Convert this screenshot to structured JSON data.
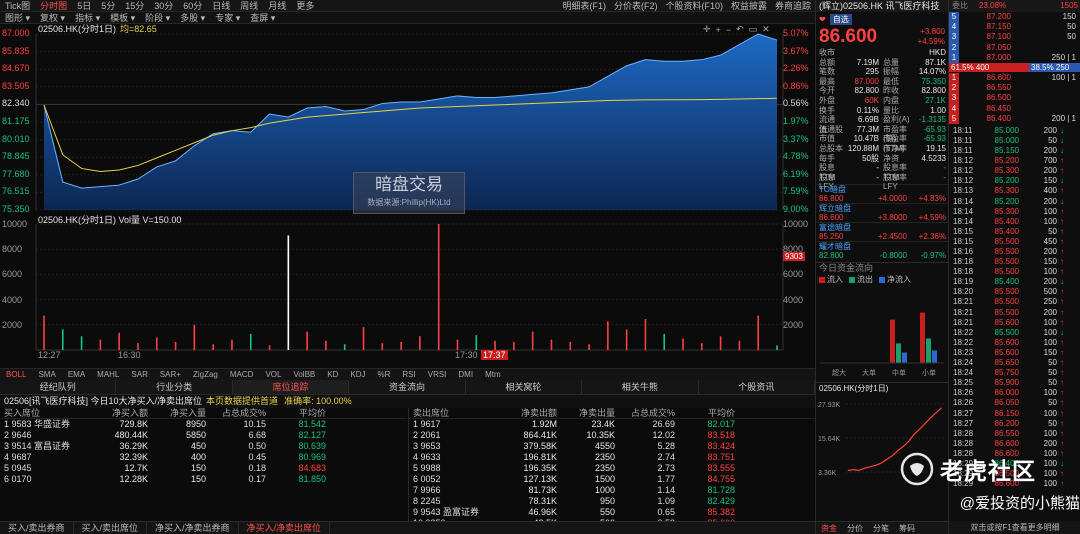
{
  "toolbar1": {
    "items": [
      "Tick图",
      "分时图",
      "5日",
      "5分",
      "15分",
      "30分",
      "60分",
      "日线",
      "周线",
      "月线",
      "更多"
    ],
    "active": 1,
    "right": [
      "明细表(F1)",
      "分价表(F2)",
      "个股资料(F10)",
      "权益披露",
      "券商追踪"
    ]
  },
  "toolbar2": {
    "items": [
      "图形",
      "复权",
      "指标",
      "模板",
      "阶段",
      "多股",
      "专家",
      "查屏"
    ]
  },
  "price_chart": {
    "label": "02506.HK(分时1日)",
    "avg_label": "均=82.65",
    "left_axis": [
      "87.000",
      "85.835",
      "84.670",
      "83.505",
      "82.340",
      "81.175",
      "80.010",
      "78.845",
      "77.680",
      "76.515",
      "75.350"
    ],
    "right_axis": [
      "5.07%",
      "3.67%",
      "2.26%",
      "0.86%",
      "0.56%",
      "1.97%",
      "3.37%",
      "4.78%",
      "6.19%",
      "7.59%",
      "9.00%"
    ],
    "watermark_title": "暗盘交易",
    "watermark_sub": "数据来源:Phillip(HK)Ltd"
  },
  "chart_data": {
    "type": "area",
    "title": "02506.HK(分时1日)",
    "ylim": [
      75.35,
      87.0
    ],
    "price": [
      82.3,
      77.2,
      76.8,
      76.9,
      77.0,
      77.4,
      78.2,
      78.6,
      79.6,
      80.4,
      80.6,
      80.5,
      81.7,
      81.5,
      82.1,
      82.2,
      81.9,
      82.0,
      82.4,
      82.5,
      82.5,
      82.7,
      82.9,
      82.8,
      82.8,
      82.9,
      83.0,
      83.1,
      83.3,
      83.5,
      84.2,
      84.9,
      85.3,
      85.2,
      85.2,
      85.3,
      85.6,
      86.3,
      87.0,
      86.6
    ],
    "avg": [
      82.3,
      79.0,
      78.1,
      77.9,
      78.0,
      78.3,
      78.8,
      79.3,
      79.8,
      80.3,
      80.6,
      80.8,
      81.1,
      81.3,
      81.5,
      81.6,
      81.7,
      81.8,
      81.9,
      82.0,
      82.1,
      82.15,
      82.2,
      82.25,
      82.3,
      82.35,
      82.4,
      82.45,
      82.5,
      82.55,
      82.6,
      82.62,
      82.64,
      82.65,
      82.65,
      82.66,
      82.67,
      82.7,
      82.72,
      82.75
    ],
    "volume": [
      3000,
      1800,
      1200,
      900,
      1500,
      600,
      1100,
      700,
      2200,
      500,
      900,
      1400,
      400,
      10000,
      1600,
      800,
      500,
      2000,
      600,
      700,
      1200,
      11000,
      900,
      1300,
      800,
      700,
      1600,
      900,
      700,
      500,
      2500,
      1800,
      2700,
      1400,
      1000,
      600,
      1200,
      800,
      3000,
      400
    ],
    "vol_label": "02506.HK(分时1日) Vol量 V=150.00",
    "vol_axis": [
      "10000",
      "8000",
      "6000",
      "4000",
      "2000"
    ],
    "vol_marker": "9303",
    "time_labels": [
      "12:27",
      "16:30",
      "17:30",
      "17:37"
    ]
  },
  "indicators": [
    "BOLL",
    "SMA",
    "EMA",
    "MAHL",
    "SAR",
    "SAR+",
    "ZigZag",
    "MACD",
    "VOL",
    "VolBB",
    "KD",
    "KDJ",
    "%R",
    "RSI",
    "VRSI",
    "DMI",
    "Mtm"
  ],
  "tabs2": [
    "经纪队列",
    "行业分类",
    "席位追踪",
    "资金流向",
    "相关窝轮",
    "相关牛熊",
    "个股资讯"
  ],
  "tabs2_active": 2,
  "broker_header": {
    "left": "02506[讯飞医疗科技]  今日10大净买入/净卖出席位",
    "warn": "本页数据提供首道",
    "rate": "准确率: 100.00%"
  },
  "buy_table": {
    "headers": [
      "买入席位",
      "净买入额",
      "净买入量",
      "占总成交%",
      "平均价"
    ],
    "rows": [
      [
        "1  9583  华盛证券",
        "729.8K",
        "8950",
        "10.15",
        "81.542"
      ],
      [
        "2  9646",
        "480.44K",
        "5850",
        "6.68",
        "82.127"
      ],
      [
        "3  9514  富昌证券",
        "36.29K",
        "450",
        "0.50",
        "80.639"
      ],
      [
        "4  9687",
        "32.39K",
        "400",
        "0.45",
        "80.969"
      ],
      [
        "5  0945",
        "12.7K",
        "150",
        "0.18",
        "84.683"
      ],
      [
        "6  0170",
        "12.28K",
        "150",
        "0.17",
        "81.850"
      ]
    ]
  },
  "sell_table": {
    "headers": [
      "卖出席位",
      "净卖出额",
      "净卖出量",
      "占总成交%",
      "平均价"
    ],
    "rows": [
      [
        "1  9617",
        "1.92M",
        "23.4K",
        "26.69",
        "82.017"
      ],
      [
        "2  2061",
        "864.41K",
        "10.35K",
        "12.02",
        "83.518"
      ],
      [
        "3  9653",
        "379.58K",
        "4550",
        "5.28",
        "83.424"
      ],
      [
        "4  9633",
        "196.81K",
        "2350",
        "2.74",
        "83.751"
      ],
      [
        "5  9988",
        "196.35K",
        "2350",
        "2.73",
        "83.555"
      ],
      [
        "6  0052",
        "127.13K",
        "1500",
        "1.77",
        "84.755"
      ],
      [
        "7  9966",
        "81.73K",
        "1000",
        "1.14",
        "81.728"
      ],
      [
        "8  2245",
        "78.31K",
        "950",
        "1.09",
        "82.429"
      ],
      [
        "9  9543  盈富证券",
        "46.96K",
        "550",
        "0.65",
        "85.382"
      ],
      [
        "10  0350",
        "42.5K",
        "500",
        "0.59",
        "85.000"
      ]
    ]
  },
  "bottom_tabs": [
    "买入/卖出券商",
    "买入/卖出席位",
    "净买入/净卖出券商",
    "净买入/净卖出席位"
  ],
  "bottom_active": 3,
  "quote": {
    "title": "(辉立)02506.HK  讯飞医疗科技",
    "badge": "自选",
    "price": "86.600",
    "change": "+3.800",
    "pct": "+4.59%",
    "currency_label": "收市",
    "currency": "HKD",
    "stats": [
      [
        "总额",
        "7.19M",
        "总量",
        "87.1K"
      ],
      [
        "笔数",
        "295",
        "振幅",
        "14.07%"
      ],
      [
        "最高",
        "87.000",
        "最低",
        "75.350"
      ],
      [
        "今开",
        "82.800",
        "昨收",
        "82.800"
      ],
      [
        "外盘",
        "60K",
        "内盘",
        "27.1K"
      ],
      [
        "换手",
        "0.11%",
        "量比",
        "1.00"
      ],
      [
        "流通值",
        "6.69B",
        "盈利(A)",
        "-1.3135"
      ],
      [
        "流通股",
        "77.3M",
        "市盈率(静)",
        "-65.93"
      ],
      [
        "市值",
        "10.47B",
        "市盈率(TTM)",
        "-65.93"
      ],
      [
        "总股本",
        "120.88M",
        "市净率",
        "19.15"
      ],
      [
        "每手",
        "50股",
        "净资",
        "4.5233"
      ],
      [
        "股息TTM",
        "-",
        "股息率TTM",
        "-"
      ],
      [
        "股息LFY",
        "-",
        "股息率LFY",
        "-"
      ]
    ],
    "markets": [
      {
        "name": "TO暗盘",
        "price": "86.800",
        "chg": "+4.0000",
        "pct": "+4.83%"
      },
      {
        "name": "辉立暗盘",
        "price": "86.600",
        "chg": "+3.8000",
        "pct": "+4.59%"
      },
      {
        "name": "富途暗盘",
        "price": "85.250",
        "chg": "+2.4500",
        "pct": "+2.36%"
      },
      {
        "name": "耀才暗盘",
        "price": "82.800",
        "chg": "-0.8000",
        "pct": "-0.97%"
      }
    ],
    "flow_title": "今日资金流向",
    "flow_legend": [
      "流入",
      "流出",
      "净流入"
    ],
    "flow_cats": [
      "超大",
      "大单",
      "中单",
      "小单"
    ],
    "mini_label": "02506.HK(分时1日)",
    "mini_axis": [
      "27.93K",
      "15.64K",
      "3.36K"
    ],
    "bottom_tabs": [
      "资金",
      "分价",
      "分笔",
      "筹码"
    ]
  },
  "book": {
    "header": [
      "委比",
      "23.08%",
      "1505"
    ],
    "asks": [
      [
        "87.200",
        "150"
      ],
      [
        "87.150",
        "50"
      ],
      [
        "87.100",
        "50"
      ],
      [
        "87.050",
        ""
      ],
      [
        "87.000",
        "250 | 1"
      ]
    ],
    "ratio_left": "61.5% 400",
    "ratio_right": "38.5% 250",
    "bids": [
      [
        "86.600",
        "100 | 1"
      ],
      [
        "86.550",
        ""
      ],
      [
        "86.500",
        ""
      ],
      [
        "86.450",
        ""
      ],
      [
        "86.400",
        "200 | 1"
      ]
    ],
    "ticks": [
      [
        "18:11",
        "85.000",
        "200",
        "down"
      ],
      [
        "18:11",
        "85.000",
        "50",
        "down"
      ],
      [
        "18:11",
        "85.150",
        "200",
        "down"
      ],
      [
        "18:12",
        "85.200",
        "700",
        "up"
      ],
      [
        "18:12",
        "85.300",
        "200",
        "up"
      ],
      [
        "18:12",
        "85.200",
        "150",
        "down"
      ],
      [
        "18:13",
        "85.300",
        "400",
        "up"
      ],
      [
        "18:14",
        "85.200",
        "200",
        "down"
      ],
      [
        "18:14",
        "85.300",
        "100",
        "up"
      ],
      [
        "18:14",
        "85.400",
        "100",
        "up"
      ],
      [
        "18:15",
        "85.400",
        "50",
        "up"
      ],
      [
        "18:15",
        "85.500",
        "450",
        "up"
      ],
      [
        "18:16",
        "85.500",
        "200",
        "up"
      ],
      [
        "18:18",
        "85.500",
        "150",
        "up"
      ],
      [
        "18:18",
        "85.500",
        "100",
        "up"
      ],
      [
        "18:19",
        "85.400",
        "200",
        "down"
      ],
      [
        "18:20",
        "85.500",
        "500",
        "up"
      ],
      [
        "18:21",
        "85.500",
        "250",
        "up"
      ],
      [
        "18:21",
        "85.500",
        "200",
        "up"
      ],
      [
        "18:21",
        "85.600",
        "100",
        "up"
      ],
      [
        "18:22",
        "85.500",
        "100",
        "down"
      ],
      [
        "18:22",
        "85.600",
        "100",
        "up"
      ],
      [
        "18:23",
        "85.600",
        "150",
        "up"
      ],
      [
        "18:24",
        "85.650",
        "50",
        "up"
      ],
      [
        "18:24",
        "85.750",
        "50",
        "up"
      ],
      [
        "18:25",
        "85.900",
        "50",
        "up"
      ],
      [
        "18:26",
        "86.000",
        "100",
        "up"
      ],
      [
        "18:26",
        "86.050",
        "50",
        "up"
      ],
      [
        "18:27",
        "86.150",
        "100",
        "up"
      ],
      [
        "18:27",
        "86.200",
        "50",
        "up"
      ],
      [
        "18:28",
        "86.550",
        "100",
        "up"
      ],
      [
        "18:28",
        "86.600",
        "200",
        "up"
      ],
      [
        "18:28",
        "86.600",
        "100",
        "up"
      ],
      [
        "18:29",
        "86.400",
        "100",
        "down"
      ],
      [
        "18:29",
        "86.500",
        "100",
        "up"
      ],
      [
        "18:29",
        "86.600",
        "100",
        "up"
      ]
    ],
    "footer": "双击或按F1查看更多明细"
  },
  "watermark": {
    "title": "老虎社区",
    "sub": "@爱投资的小熊猫"
  },
  "colors": {
    "up": "#ff4040",
    "down": "#19c37d",
    "area": "#1e6fd0",
    "avg": "#e8d24a"
  }
}
